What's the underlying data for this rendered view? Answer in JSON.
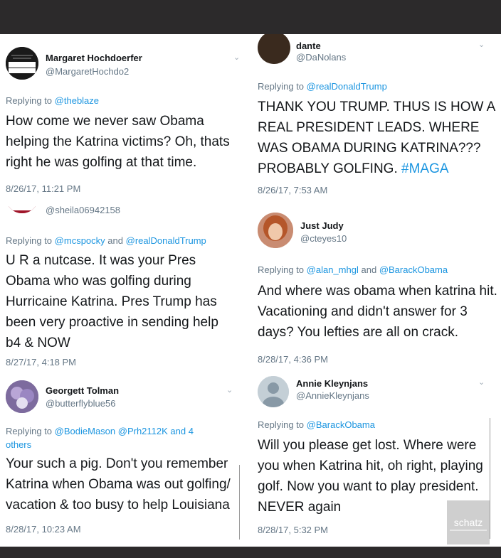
{
  "tweets": [
    {
      "name": "Margaret Hochdoerfer",
      "handle": "@MargaretHochdo2",
      "avatar_text": "HAVE HAD ENOUGH",
      "reply_prefix": "Replying to",
      "reply_to": "@theblaze",
      "body": "How come we never saw Obama helping the Katrina victims? Oh, thats right he was golfing at that time.",
      "time": "8/26/17, 11:21 PM"
    },
    {
      "handle": "@sheila06942158",
      "reply_prefix": "Replying to",
      "reply_to": "@mcspocky",
      "reply_joiner": "and",
      "reply_to_2": "@realDonaldTrump",
      "body": "U R a nutcase. It was your Pres Obama who was golfing during Hurricaine Katrina. Pres Trump has been very proactive in sending help b4 & NOW",
      "time": "8/27/17, 4:18 PM"
    },
    {
      "name": "Georgett Tolman",
      "handle": "@butterflyblue56",
      "reply_prefix": "Replying to",
      "reply_to": "@BodieMason @Prh2112K and 4 others",
      "body": "Your such a pig. Don't you remember Katrina when Obama was out golfing/ vacation & too busy to help Louisiana",
      "time": "8/28/17, 10:23 AM"
    },
    {
      "name": "dante",
      "handle": "@DaNolans",
      "reply_prefix": "Replying to",
      "reply_to": "@realDonaldTrump",
      "body": "THANK YOU TRUMP.  THUS IS HOW A REAL PRESIDENT LEADS.  WHERE WAS OBAMA DURING KATRINA??? PROBABLY GOLFING.",
      "hashtag": "#MAGA",
      "time": "8/26/17, 7:53 AM"
    },
    {
      "name": "Just Judy",
      "handle": "@cteyes10",
      "reply_prefix": "Replying to",
      "reply_to": "@alan_mhgl",
      "reply_joiner": "and",
      "reply_to_2": "@BarackObama",
      "body": "And where was obama when katrina hit. Vacationing and didn't answer for 3 days? You lefties are all on crack.",
      "time": "8/28/17, 4:36 PM"
    },
    {
      "name": "Annie Kleynjans",
      "handle": "@AnnieKleynjans",
      "reply_prefix": "Replying to",
      "reply_to": "@BarackObama",
      "body": "Will you please get lost.  Where were you when Katrina hit, oh right, playing golf. Now you want to play president. NEVER again",
      "time": "8/28/17, 5:32 PM"
    }
  ],
  "icons": {
    "chevron": "chevron-down-icon",
    "default_avatar": "default-avatar-icon"
  },
  "watermark": "schatz",
  "colors": {
    "link": "#1b95e0",
    "secondary": "#657786",
    "text": "#14171a",
    "frame": "#2c2a2b"
  }
}
